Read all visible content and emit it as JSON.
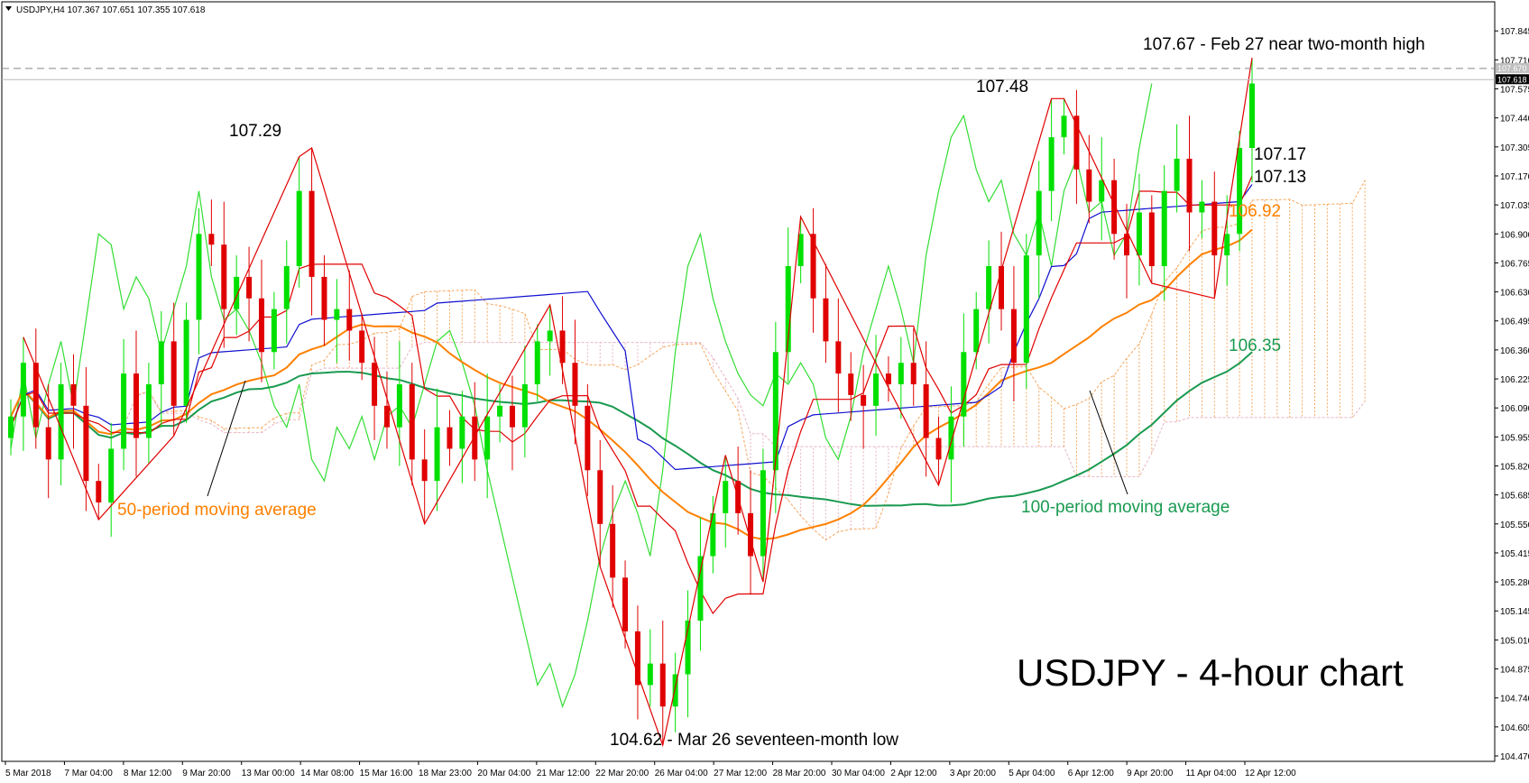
{
  "window": {
    "symbol_header": "USDJPY,H4  107.367 107.651 107.355 107.618"
  },
  "chart_data": {
    "type": "candlestick",
    "title": "USDJPY - 4-hour chart",
    "ylim": [
      104.47,
      107.93
    ],
    "y_ticks": [
      "107.845",
      "107.710",
      "107.575",
      "107.440",
      "107.305",
      "107.170",
      "107.035",
      "106.900",
      "106.765",
      "106.630",
      "106.495",
      "106.360",
      "106.225",
      "106.090",
      "105.955",
      "105.820",
      "105.685",
      "105.550",
      "105.415",
      "105.280",
      "105.145",
      "105.010",
      "104.875",
      "104.740",
      "104.605",
      "104.470"
    ],
    "price_markers": [
      {
        "label": "107.670",
        "value": 107.67,
        "color": "#c0c0c0"
      },
      {
        "label": "107.618",
        "value": 107.618,
        "color": "#000000"
      }
    ],
    "x_ticks": [
      "5 Mar 2018",
      "7 Mar 04:00",
      "8 Mar 12:00",
      "9 Mar 20:00",
      "13 Mar 00:00",
      "14 Mar 08:00",
      "15 Mar 16:00",
      "18 Mar 23:00",
      "20 Mar 04:00",
      "21 Mar 12:00",
      "22 Mar 20:00",
      "26 Mar 04:00",
      "27 Mar 12:00",
      "28 Mar 20:00",
      "30 Mar 04:00",
      "2 Apr 12:00",
      "3 Apr 20:00",
      "5 Apr 04:00",
      "6 Apr 12:00",
      "9 Apr 20:00",
      "11 Apr 04:00",
      "12 Apr 12:00"
    ],
    "candles_close": [
      106.05,
      106.3,
      106.0,
      105.85,
      106.2,
      106.1,
      105.75,
      105.65,
      105.9,
      106.25,
      105.95,
      106.2,
      106.4,
      106.1,
      106.5,
      106.9,
      106.85,
      106.55,
      106.7,
      106.6,
      106.35,
      106.55,
      106.75,
      107.1,
      106.7,
      106.5,
      106.55,
      106.45,
      106.3,
      106.1,
      106.0,
      106.2,
      105.85,
      105.75,
      106.0,
      105.9,
      106.05,
      105.85,
      106.05,
      106.1,
      106.0,
      106.2,
      106.4,
      106.45,
      106.3,
      106.1,
      105.8,
      105.55,
      105.3,
      105.05,
      104.8,
      104.9,
      104.7,
      104.85,
      105.1,
      105.4,
      105.6,
      105.75,
      105.6,
      105.4,
      105.8,
      106.35,
      106.75,
      106.9,
      106.6,
      106.4,
      106.25,
      106.15,
      106.1,
      106.25,
      106.2,
      106.3,
      106.2,
      105.95,
      105.85,
      106.05,
      106.35,
      106.55,
      106.75,
      106.55,
      106.3,
      106.8,
      107.1,
      107.35,
      107.45,
      107.2,
      107.05,
      107.15,
      106.9,
      106.8,
      107.0,
      106.75,
      107.1,
      107.25,
      107.0,
      107.05,
      106.8,
      106.9,
      107.3,
      107.6
    ],
    "lines": {
      "ma50_end": 106.92,
      "ma100_end": 106.35,
      "tenkan_end": 107.17,
      "kijun_end": 107.13
    },
    "series_labels": {
      "ma50": "50-period moving average",
      "ma100": "100-period moving average"
    },
    "annotations": {
      "high_1": "107.29",
      "high_2": "107.48",
      "top_note": "107.67 - Feb 27 near two-month high",
      "tenkan_label": "107.17",
      "kijun_label": "107.13",
      "ma50_label": "106.92",
      "ma100_label": "106.35",
      "low_note": "104.62 - Mar 26 seventeen-month low"
    },
    "colors": {
      "bull": "#00e000",
      "bear": "#e00000",
      "ma50": "#ff8000",
      "ma100": "#1a9a50",
      "tenkan": "#e00000",
      "kijun": "#1010d0",
      "chikou": "#33dd33",
      "cloud_up": "#f5a860",
      "cloud_down": "#e6b5c3"
    }
  }
}
